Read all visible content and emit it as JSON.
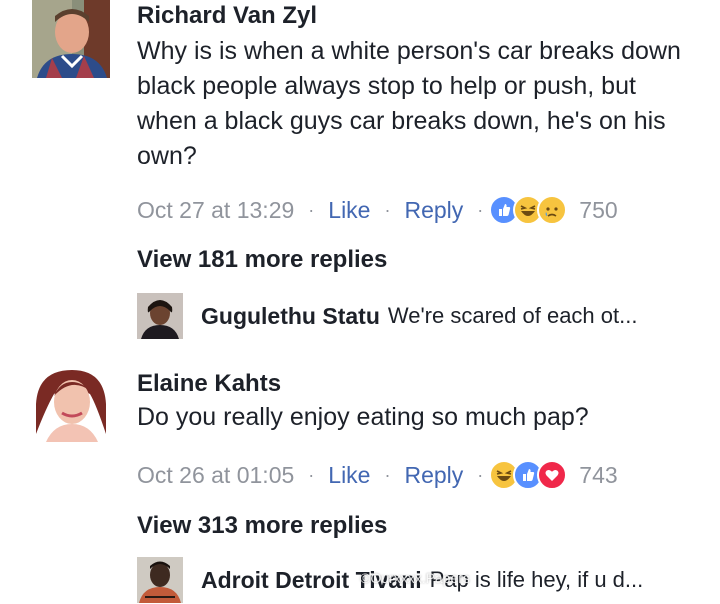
{
  "comments": [
    {
      "author": "Richard Van Zyl",
      "text": "Why is is when a white person's car breaks down black people always stop to help or push, but when a black guys car breaks down, he's on his own?",
      "timestamp": "Oct 27 at 13:29",
      "like_label": "Like",
      "reply_label": "Reply",
      "reactions": [
        "like",
        "haha",
        "sad"
      ],
      "reaction_count": "750",
      "view_more": "View 181 more replies",
      "latest_reply": {
        "author": "Gugulethu Statu",
        "snippet": "We're scared of each ot..."
      }
    },
    {
      "author": "Elaine Kahts",
      "text": "Do you really enjoy eating so much pap?",
      "timestamp": "Oct 26 at 01:05",
      "like_label": "Like",
      "reply_label": "Reply",
      "reactions": [
        "haha",
        "like",
        "love"
      ],
      "reaction_count": "743",
      "view_more": "View 313 more replies",
      "latest_reply": {
        "author": "Adroit Detroit Tivani",
        "snippet": "Pap is life hey, if u d..."
      }
    }
  ],
  "separator": "·",
  "watermark": "©Ourxxxx.Papers",
  "colors": {
    "link": "#4267b2",
    "meta": "#90949c",
    "text": "#1d2129",
    "like": "#5890ff",
    "haha": "#f7c43f",
    "love": "#f0284a"
  }
}
